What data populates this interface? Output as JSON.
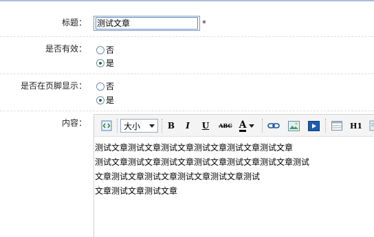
{
  "form": {
    "title_label": "标题：",
    "title_value": "测试文章",
    "required_mark": "*",
    "valid_label": "是否有效：",
    "valid_options": [
      {
        "label": "否",
        "checked": false
      },
      {
        "label": "是",
        "checked": true
      }
    ],
    "footer_label": "是否在页脚显示：",
    "footer_options": [
      {
        "label": "否",
        "checked": false
      },
      {
        "label": "是",
        "checked": true
      }
    ],
    "content_label": "内容："
  },
  "editor": {
    "toolbar": {
      "size_label": "大小",
      "bold": "B",
      "italic": "I",
      "underline": "U",
      "strike": "ABC",
      "font_color": "A",
      "heading": "H1"
    },
    "paragraphs": [
      "测试文章测试文章测试文章测试文章测试文章测试文章",
      "测试文章测试文章测试文章测试文章测试文章测试文章测试",
      "文章测试文章测试文章测试文章测试文章测试",
      "文章测试文章测试文章"
    ]
  }
}
